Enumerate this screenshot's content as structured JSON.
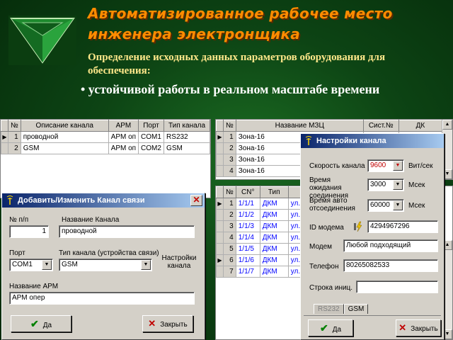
{
  "slide": {
    "title_line1": "Автоматизированное рабочее место",
    "title_line2": "инженера электронщика",
    "subtitle": "Определение исходных данных  параметров оборудования для обеспечения:",
    "bullet": "• устойчивой работы в реальном масштабе времени"
  },
  "channels_grid": {
    "headers": [
      "№",
      "Описание канала",
      "АРМ",
      "Порт",
      "Тип канала"
    ],
    "rows": [
      {
        "n": "1",
        "desc": "проводной",
        "arm": "АРМ оп",
        "port": "COM1",
        "type": "RS232"
      },
      {
        "n": "2",
        "desc": "GSM",
        "arm": "АРМ оп",
        "port": "COM2",
        "type": "GSM"
      }
    ]
  },
  "mzs_grid": {
    "headers": [
      "№",
      "Название МЗЦ",
      "Сист.№",
      "ДК"
    ],
    "rows": [
      {
        "n": "1",
        "name": "Зона-16"
      },
      {
        "n": "2",
        "name": "Зона-16"
      },
      {
        "n": "3",
        "name": "Зона-16"
      },
      {
        "n": "4",
        "name": "Зона-16"
      }
    ]
  },
  "sensors_grid": {
    "headers": [
      "№",
      "СN°",
      "Тип"
    ],
    "rows": [
      {
        "n": "1",
        "cn": "1/1/1",
        "type": "ДКМ",
        "extra": "ул."
      },
      {
        "n": "2",
        "cn": "1/1/2",
        "type": "ДКМ",
        "extra": "ул."
      },
      {
        "n": "3",
        "cn": "1/1/3",
        "type": "ДКМ",
        "extra": "ул."
      },
      {
        "n": "4",
        "cn": "1/1/4",
        "type": "ДКМ",
        "extra": "ул."
      },
      {
        "n": "5",
        "cn": "1/1/5",
        "type": "ДКМ",
        "extra": "ул."
      },
      {
        "n": "6",
        "cn": "1/1/6",
        "type": "ДКМ",
        "extra": "ул."
      },
      {
        "n": "7",
        "cn": "1/1/7",
        "type": "ДКМ",
        "extra": "ул."
      }
    ]
  },
  "dialog_channel": {
    "title": "Добавить/Изменить Канал связи",
    "num_label": "№ п/п",
    "num_value": "1",
    "name_label": "Название Канала",
    "name_value": "проводной",
    "port_label": "Порт",
    "port_value": "COM1",
    "type_label": "Тип канала (устройства связи)",
    "type_value": "GSM",
    "settings_label": "Настройки канала",
    "arm_label": "Название АРМ",
    "arm_value": "АРМ опер",
    "ok_label": "Да",
    "close_label": "Закрыть"
  },
  "dialog_settings": {
    "title": "Настройки канала",
    "speed_label": "Скорость канала",
    "speed_value": "9600",
    "speed_unit": "Вит/сек",
    "wait_label": "Время ожидания соединения",
    "wait_value": "3000",
    "wait_unit": "Мсек",
    "auto_label": "Время авто отсоединения",
    "auto_value": "60000",
    "auto_unit": "Мсек",
    "id_label": "ID модема",
    "id_value": "4294967296",
    "modem_label": "Модем",
    "modem_value": "Любой подходящий",
    "phone_label": "Телефон",
    "phone_value": "80265082533",
    "init_label": "Строка иниц.",
    "init_value": "",
    "tab_rs232": "RS232",
    "tab_gsm": "GSM",
    "ok_label": "Да",
    "close_label": "Закрыть"
  },
  "colors": {
    "title": "#ff8c00",
    "subtitle": "#ffe88a",
    "titlebar": "#0a246a",
    "speed_value": "#c00000"
  }
}
